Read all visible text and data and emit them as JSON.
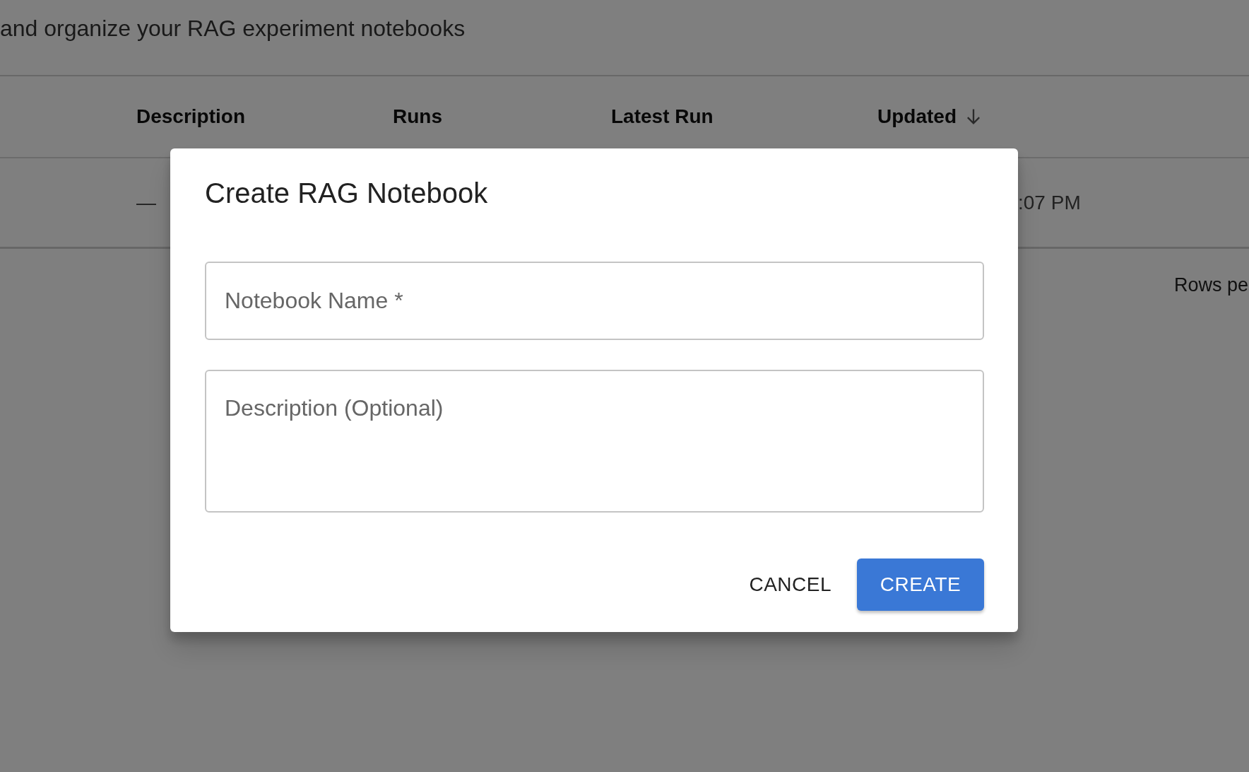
{
  "page": {
    "subtitle": "and organize your RAG experiment notebooks"
  },
  "table": {
    "columns": [
      {
        "label": "Description",
        "sorted": false
      },
      {
        "label": "Runs",
        "sorted": false
      },
      {
        "label": "Latest Run",
        "sorted": false
      },
      {
        "label": "Updated",
        "sorted": true
      }
    ],
    "rows": [
      {
        "description": "—",
        "updated": ":07 PM"
      }
    ]
  },
  "pagination": {
    "rows_per_page_label": "Rows pe"
  },
  "dialog": {
    "title": "Create RAG Notebook",
    "fields": [
      {
        "kind": "text",
        "placeholder": "Notebook Name *"
      },
      {
        "kind": "multiline",
        "placeholder": "Description (Optional)"
      }
    ],
    "buttons": [
      {
        "label": "CANCEL",
        "kind": "text"
      },
      {
        "label": "CREATE",
        "kind": "contained"
      }
    ]
  }
}
